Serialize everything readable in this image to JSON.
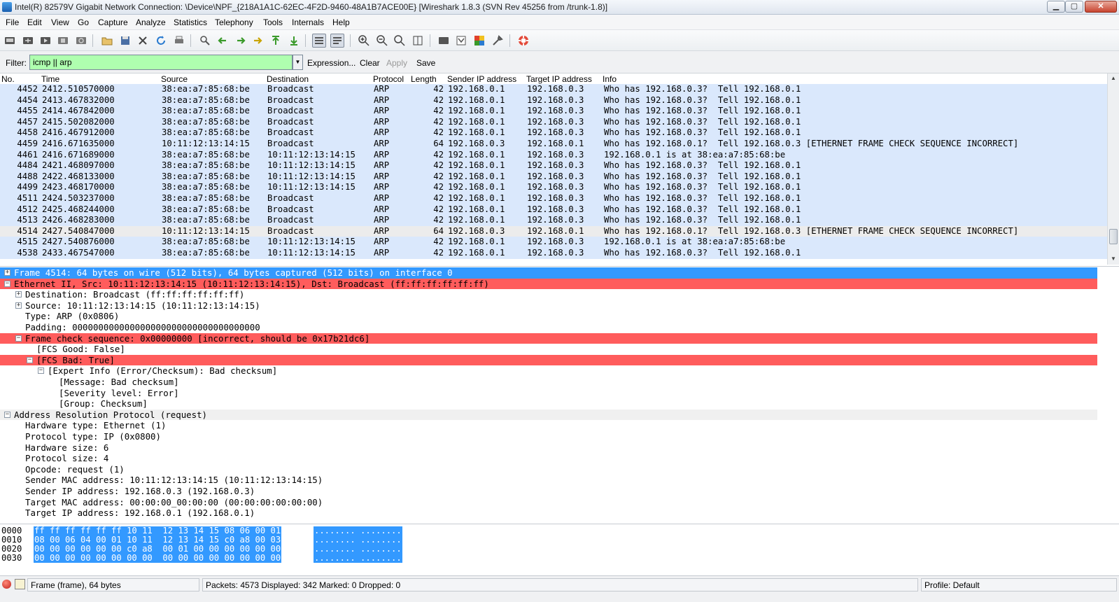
{
  "window": {
    "title": "Intel(R) 82579V Gigabit Network Connection: \\Device\\NPF_{218A1A1C-62EC-4F2D-9460-48A1B7ACE00E}   [Wireshark 1.8.3  (SVN Rev 45256 from /trunk-1.8)]",
    "min_label": "▁",
    "max_label": "▢",
    "close_label": "✕"
  },
  "menu": [
    "File",
    "Edit",
    "View",
    "Go",
    "Capture",
    "Analyze",
    "Statistics",
    "Telephony",
    "Tools",
    "Internals",
    "Help"
  ],
  "toolbar_icons": [
    "interfaces-icon",
    "options-icon",
    "start-capture-icon",
    "stop-capture-icon",
    "restart-capture-icon",
    "open-file-icon",
    "save-file-icon",
    "close-file-icon",
    "reload-icon",
    "print-icon",
    "find-packet-icon",
    "go-back-icon",
    "go-forward-icon",
    "go-to-packet-icon",
    "go-first-icon",
    "go-last-icon",
    "colorize-icon",
    "autoscroll-icon",
    "zoom-in-icon",
    "zoom-out-icon",
    "normal-size-icon",
    "resize-columns-icon",
    "capture-filters-icon",
    "display-filters-icon",
    "coloring-rules-icon",
    "preferences-icon",
    "help-icon"
  ],
  "filter": {
    "label": "Filter:",
    "value": "icmp || arp",
    "expression": "Expression...",
    "clear": "Clear",
    "apply": "Apply",
    "save": "Save"
  },
  "packet_list": {
    "columns": [
      "No.",
      "Time",
      "Source",
      "Destination",
      "Protocol",
      "Length",
      "Sender IP address",
      "Target IP address",
      "Info"
    ],
    "rows": [
      {
        "no": "4452",
        "time": "2412.510570000",
        "src": "38:ea:a7:85:68:be",
        "dst": "Broadcast",
        "proto": "ARP",
        "len": "42",
        "sip": "192.168.0.1",
        "tip": "192.168.0.3",
        "info": "Who has 192.168.0.3?  Tell 192.168.0.1",
        "fcs": false
      },
      {
        "no": "4454",
        "time": "2413.467832000",
        "src": "38:ea:a7:85:68:be",
        "dst": "Broadcast",
        "proto": "ARP",
        "len": "42",
        "sip": "192.168.0.1",
        "tip": "192.168.0.3",
        "info": "Who has 192.168.0.3?  Tell 192.168.0.1",
        "fcs": false
      },
      {
        "no": "4455",
        "time": "2414.467842000",
        "src": "38:ea:a7:85:68:be",
        "dst": "Broadcast",
        "proto": "ARP",
        "len": "42",
        "sip": "192.168.0.1",
        "tip": "192.168.0.3",
        "info": "Who has 192.168.0.3?  Tell 192.168.0.1",
        "fcs": false
      },
      {
        "no": "4457",
        "time": "2415.502082000",
        "src": "38:ea:a7:85:68:be",
        "dst": "Broadcast",
        "proto": "ARP",
        "len": "42",
        "sip": "192.168.0.1",
        "tip": "192.168.0.3",
        "info": "Who has 192.168.0.3?  Tell 192.168.0.1",
        "fcs": false
      },
      {
        "no": "4458",
        "time": "2416.467912000",
        "src": "38:ea:a7:85:68:be",
        "dst": "Broadcast",
        "proto": "ARP",
        "len": "42",
        "sip": "192.168.0.1",
        "tip": "192.168.0.3",
        "info": "Who has 192.168.0.3?  Tell 192.168.0.1",
        "fcs": false
      },
      {
        "no": "4459",
        "time": "2416.671635000",
        "src": "10:11:12:13:14:15",
        "dst": "Broadcast",
        "proto": "ARP",
        "len": "64",
        "sip": "192.168.0.3",
        "tip": "192.168.0.1",
        "info": "Who has 192.168.0.1?  Tell 192.168.0.3 [ETHERNET FRAME CHECK SEQUENCE INCORRECT]",
        "fcs": false
      },
      {
        "no": "4461",
        "time": "2416.671689000",
        "src": "38:ea:a7:85:68:be",
        "dst": "10:11:12:13:14:15",
        "proto": "ARP",
        "len": "42",
        "sip": "192.168.0.1",
        "tip": "192.168.0.3",
        "info": "192.168.0.1 is at 38:ea:a7:85:68:be",
        "fcs": false
      },
      {
        "no": "4484",
        "time": "2421.468097000",
        "src": "38:ea:a7:85:68:be",
        "dst": "10:11:12:13:14:15",
        "proto": "ARP",
        "len": "42",
        "sip": "192.168.0.1",
        "tip": "192.168.0.3",
        "info": "Who has 192.168.0.3?  Tell 192.168.0.1",
        "fcs": false
      },
      {
        "no": "4488",
        "time": "2422.468133000",
        "src": "38:ea:a7:85:68:be",
        "dst": "10:11:12:13:14:15",
        "proto": "ARP",
        "len": "42",
        "sip": "192.168.0.1",
        "tip": "192.168.0.3",
        "info": "Who has 192.168.0.3?  Tell 192.168.0.1",
        "fcs": false
      },
      {
        "no": "4499",
        "time": "2423.468170000",
        "src": "38:ea:a7:85:68:be",
        "dst": "10:11:12:13:14:15",
        "proto": "ARP",
        "len": "42",
        "sip": "192.168.0.1",
        "tip": "192.168.0.3",
        "info": "Who has 192.168.0.3?  Tell 192.168.0.1",
        "fcs": false
      },
      {
        "no": "4511",
        "time": "2424.503237000",
        "src": "38:ea:a7:85:68:be",
        "dst": "Broadcast",
        "proto": "ARP",
        "len": "42",
        "sip": "192.168.0.1",
        "tip": "192.168.0.3",
        "info": "Who has 192.168.0.3?  Tell 192.168.0.1",
        "fcs": false
      },
      {
        "no": "4512",
        "time": "2425.468244000",
        "src": "38:ea:a7:85:68:be",
        "dst": "Broadcast",
        "proto": "ARP",
        "len": "42",
        "sip": "192.168.0.1",
        "tip": "192.168.0.3",
        "info": "Who has 192.168.0.3?  Tell 192.168.0.1",
        "fcs": false
      },
      {
        "no": "4513",
        "time": "2426.468283000",
        "src": "38:ea:a7:85:68:be",
        "dst": "Broadcast",
        "proto": "ARP",
        "len": "42",
        "sip": "192.168.0.1",
        "tip": "192.168.0.3",
        "info": "Who has 192.168.0.3?  Tell 192.168.0.1",
        "fcs": false
      },
      {
        "no": "4514",
        "time": "2427.540847000",
        "src": "10:11:12:13:14:15",
        "dst": "Broadcast",
        "proto": "ARP",
        "len": "64",
        "sip": "192.168.0.3",
        "tip": "192.168.0.1",
        "info": "Who has 192.168.0.1?  Tell 192.168.0.3 [ETHERNET FRAME CHECK SEQUENCE INCORRECT]",
        "fcs": true
      },
      {
        "no": "4515",
        "time": "2427.540876000",
        "src": "38:ea:a7:85:68:be",
        "dst": "10:11:12:13:14:15",
        "proto": "ARP",
        "len": "42",
        "sip": "192.168.0.1",
        "tip": "192.168.0.3",
        "info": "192.168.0.1 is at 38:ea:a7:85:68:be",
        "fcs": false
      },
      {
        "no": "4538",
        "time": "2433.467547000",
        "src": "38:ea:a7:85:68:be",
        "dst": "10:11:12:13:14:15",
        "proto": "ARP",
        "len": "42",
        "sip": "192.168.0.1",
        "tip": "192.168.0.3",
        "info": "Who has 192.168.0.3?  Tell 192.168.0.1",
        "fcs": false
      }
    ]
  },
  "details": [
    {
      "indent": 0,
      "toggle": "+",
      "style": "sel",
      "text": "Frame 4514: 64 bytes on wire (512 bits), 64 bytes captured (512 bits) on interface 0"
    },
    {
      "indent": 0,
      "toggle": "-",
      "style": "err",
      "text": "Ethernet II, Src: 10:11:12:13:14:15 (10:11:12:13:14:15), Dst: Broadcast (ff:ff:ff:ff:ff:ff)"
    },
    {
      "indent": 1,
      "toggle": "+",
      "style": "",
      "text": "Destination: Broadcast (ff:ff:ff:ff:ff:ff)"
    },
    {
      "indent": 1,
      "toggle": "+",
      "style": "",
      "text": "Source: 10:11:12:13:14:15 (10:11:12:13:14:15)"
    },
    {
      "indent": 1,
      "toggle": "",
      "style": "",
      "text": "Type: ARP (0x0806)"
    },
    {
      "indent": 1,
      "toggle": "",
      "style": "",
      "text": "Padding: 000000000000000000000000000000000000"
    },
    {
      "indent": 1,
      "toggle": "-",
      "style": "err",
      "text": "Frame check sequence: 0x00000000 [incorrect, should be 0x17b21dc6]"
    },
    {
      "indent": 2,
      "toggle": "",
      "style": "",
      "text": "[FCS Good: False]"
    },
    {
      "indent": 2,
      "toggle": "-",
      "style": "err",
      "text": "[FCS Bad: True]"
    },
    {
      "indent": 3,
      "toggle": "-",
      "style": "",
      "text": "[Expert Info (Error/Checksum): Bad checksum]"
    },
    {
      "indent": 4,
      "toggle": "",
      "style": "",
      "text": "[Message: Bad checksum]"
    },
    {
      "indent": 4,
      "toggle": "",
      "style": "",
      "text": "[Severity level: Error]"
    },
    {
      "indent": 4,
      "toggle": "",
      "style": "",
      "text": "[Group: Checksum]"
    },
    {
      "indent": 0,
      "toggle": "-",
      "style": "hdr",
      "text": "Address Resolution Protocol (request)"
    },
    {
      "indent": 1,
      "toggle": "",
      "style": "",
      "text": "Hardware type: Ethernet (1)"
    },
    {
      "indent": 1,
      "toggle": "",
      "style": "",
      "text": "Protocol type: IP (0x0800)"
    },
    {
      "indent": 1,
      "toggle": "",
      "style": "",
      "text": "Hardware size: 6"
    },
    {
      "indent": 1,
      "toggle": "",
      "style": "",
      "text": "Protocol size: 4"
    },
    {
      "indent": 1,
      "toggle": "",
      "style": "",
      "text": "Opcode: request (1)"
    },
    {
      "indent": 1,
      "toggle": "",
      "style": "",
      "text": "Sender MAC address: 10:11:12:13:14:15 (10:11:12:13:14:15)"
    },
    {
      "indent": 1,
      "toggle": "",
      "style": "",
      "text": "Sender IP address: 192.168.0.3 (192.168.0.3)"
    },
    {
      "indent": 1,
      "toggle": "",
      "style": "",
      "text": "Target MAC address: 00:00:00_00:00:00 (00:00:00:00:00:00)"
    },
    {
      "indent": 1,
      "toggle": "",
      "style": "",
      "text": "Target IP address: 192.168.0.1 (192.168.0.1)"
    }
  ],
  "bytes": [
    {
      "offset": "0000",
      "hex": "ff ff ff ff ff ff 10 11  12 13 14 15 08 06 00 01",
      "ascii": "........ ........"
    },
    {
      "offset": "0010",
      "hex": "08 00 06 04 00 01 10 11  12 13 14 15 c0 a8 00 03",
      "ascii": "........ ........"
    },
    {
      "offset": "0020",
      "hex": "00 00 00 00 00 00 c0 a8  00 01 00 00 00 00 00 00",
      "ascii": "........ ........"
    },
    {
      "offset": "0030",
      "hex": "00 00 00 00 00 00 00 00  00 00 00 00 00 00 00 00",
      "ascii": "........ ........"
    }
  ],
  "status": {
    "frame": "Frame (frame), 64 bytes",
    "packets": "Packets: 4573 Displayed: 342 Marked: 0 Dropped: 0",
    "profile": "Profile: Default"
  },
  "colors": {
    "row_bg": "#dae8fc",
    "row_fcs_bg": "#ececec",
    "selected": "#3399ff",
    "error": "#ff5c5c",
    "filter_ok": "#afffaf"
  }
}
